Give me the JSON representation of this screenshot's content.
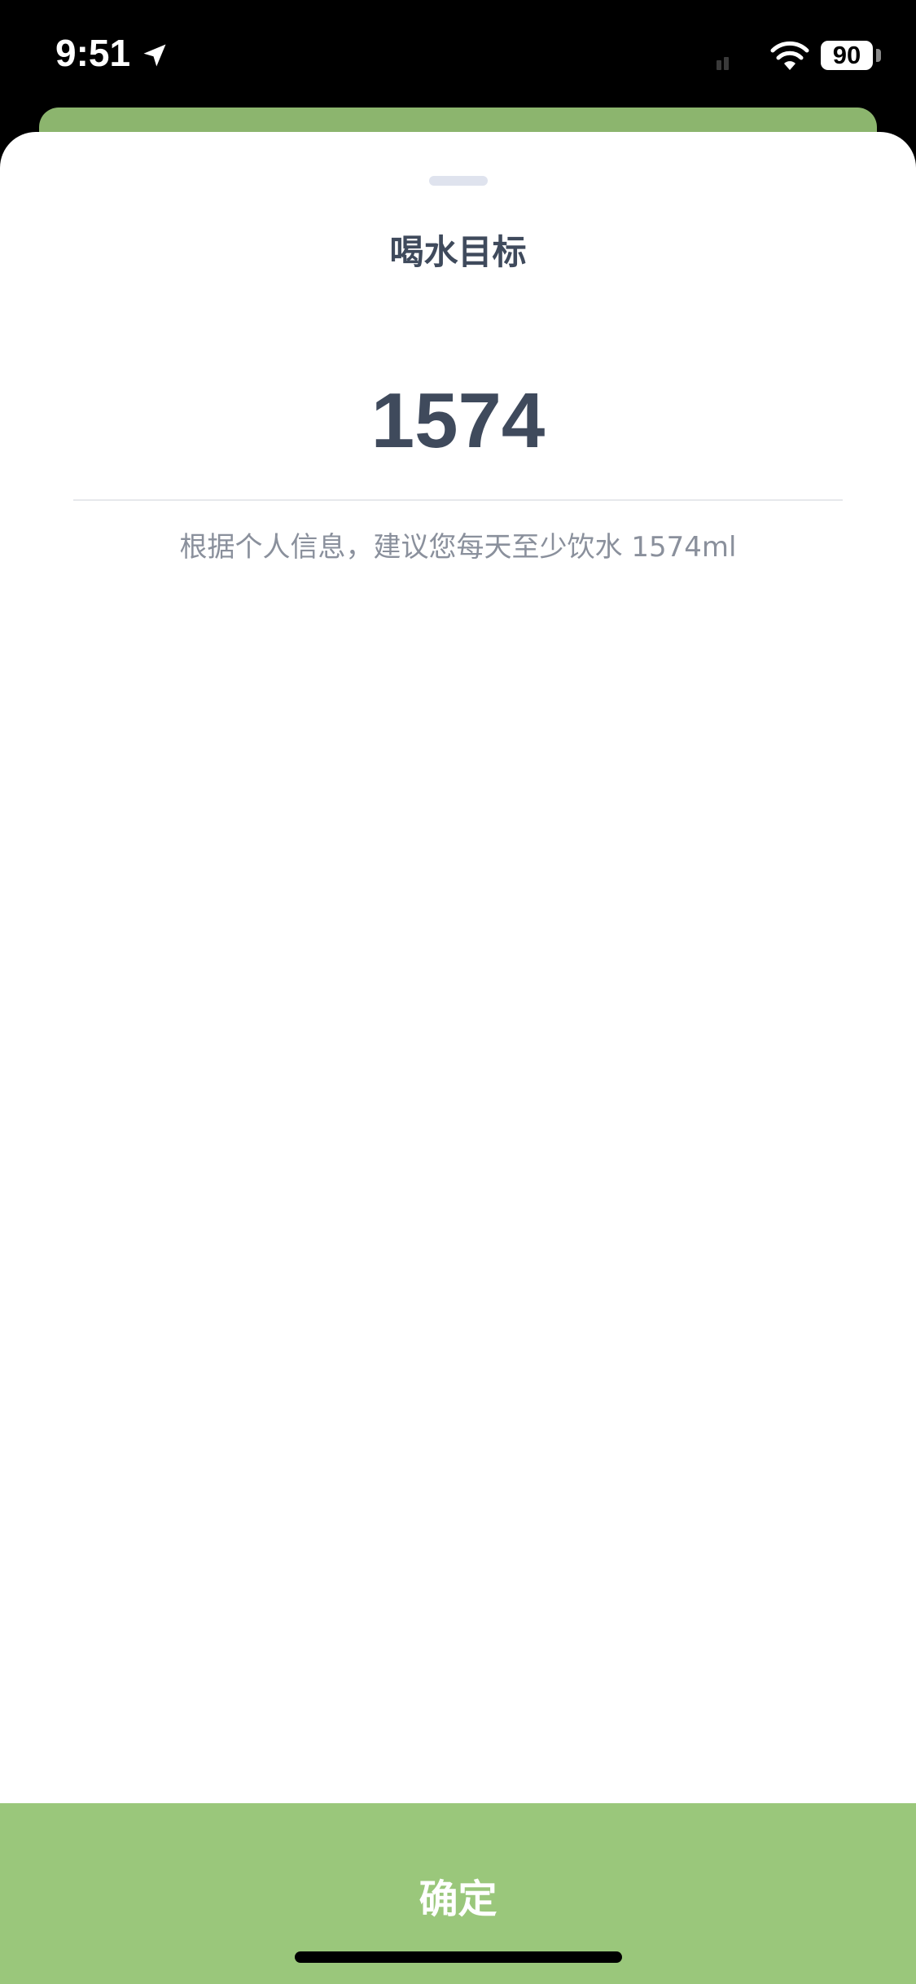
{
  "status_bar": {
    "time": "9:51",
    "battery": "90"
  },
  "sheet": {
    "title": "喝水目标",
    "goal_value": "1574",
    "hint": "根据个人信息，建议您每天至少饮水 1574ml"
  },
  "confirm": {
    "label": "确定"
  },
  "colors": {
    "accent_green": "#9ac77b",
    "header_green": "#8cb56e",
    "title_text": "#3f4a5c",
    "hint_text": "#8a909c"
  },
  "icons": {
    "location": "location-arrow-icon",
    "signal": "cellular-signal-icon",
    "wifi": "wifi-icon"
  }
}
